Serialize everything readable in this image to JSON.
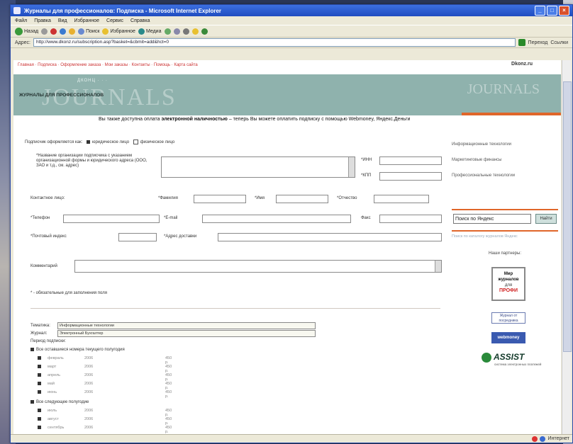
{
  "window": {
    "title": "Журналы для профессионалов: Подписка - Microsoft Internet Explorer",
    "controls": [
      "_",
      "□",
      "×"
    ]
  },
  "menu": [
    "Файл",
    "Правка",
    "Вид",
    "Избранное",
    "Сервис",
    "Справка"
  ],
  "toolbar": {
    "back": "Назад",
    "search": "Поиск",
    "favorites": "Избранное",
    "media": "Медиа"
  },
  "address": {
    "label": "Адрес:",
    "url": "http://www.dkonz.ru/subscription.asp?basket=&cbmit=add&hct=0",
    "go": "Переход",
    "links": "Ссылки"
  },
  "page": {
    "breadcrumb": "Главная · Подписка · Оформление заказа · Мои заказы · Контакты · Помощь · Карта сайта",
    "site_logo": "Dkonz.ru",
    "banner_tiny": "ДКОНЦ · · ·",
    "banner_ghost": "JOURNALS",
    "banner_ghost_right": "JOURNALS",
    "banner_sub": "ЖУРНАЛЫ ДЛЯ ПРОФЕССИОНАЛОВ",
    "notice_prefix": "Вы также доступна оплата",
    "notice_bold": "электронной наличностью",
    "notice_suffix": "– теперь Вы можете оплатить подписку с помощью Webmoney, Яндекс.Деньги"
  },
  "form": {
    "subscriber_type_label": "Подписчик оформляется как:",
    "subscriber_legal": "юридическое лицо",
    "subscriber_individual": "физическое лицо",
    "org_label": "*Название организации подписчика с указанием организационной формы и юридического адреса (ООО, ЗАО и т.д., см. адрес)",
    "inn_label": "*ИНН",
    "kpp_label": "*КПП",
    "contact_label": "Контактное лицо:",
    "surname_label": "*Фамилия",
    "name_label": "*Имя",
    "patronymic_label": "*Отчество",
    "phone_label": "*Телефон",
    "email_label": "*E-mail",
    "fax_label": "Факс",
    "postal_label": "*Почтовый индекс",
    "address_label": "*Адрес доставки",
    "comment_label": "Комментарий",
    "required_note": "* - обязательные для заполнения поля",
    "topic_label": "Тематика:",
    "topic_value": "Информационные технологии",
    "journal_label": "Журнал:",
    "journal_value": "Электронный Бухгалтер",
    "period_label": "Период подписки:",
    "group1_label": "Все оставшиеся номера текущего полугодия",
    "group1_rows": [
      {
        "month": "февраль",
        "year": "2006",
        "price": "450 р."
      },
      {
        "month": "март",
        "year": "2006",
        "price": "450 р."
      },
      {
        "month": "апрель",
        "year": "2006",
        "price": "450 р."
      },
      {
        "month": "май",
        "year": "2006",
        "price": "450 р."
      },
      {
        "month": "июнь",
        "year": "2006",
        "price": "450 р."
      }
    ],
    "group2_label": "Все следующее полугодие",
    "group2_rows": [
      {
        "month": "июль",
        "year": "2006",
        "price": "450 р."
      },
      {
        "month": "август",
        "year": "2006",
        "price": "450 р."
      },
      {
        "month": "сентябрь",
        "year": "2006",
        "price": "450 р."
      }
    ]
  },
  "sidebar": {
    "links": [
      "Информационные технологии",
      "Маркетинговые финансы",
      "Профессиональные технологии"
    ],
    "search_value": "Поиск по Яндекс",
    "search_button": "Найти",
    "caption": "Поиск по каталогу журналов Яндекс",
    "partners_title": "Наши партнеры:",
    "badge1_line1": "Мир",
    "badge1_line2": "журналов",
    "badge1_line3": "для",
    "badge1_line4": "ПРОФИ",
    "badge2": "Журнал от посредника",
    "badge3": "webmoney",
    "assist": "ASSIST",
    "assist_cap": "система электронных платежей"
  },
  "status": {
    "zone": "Интернет"
  }
}
